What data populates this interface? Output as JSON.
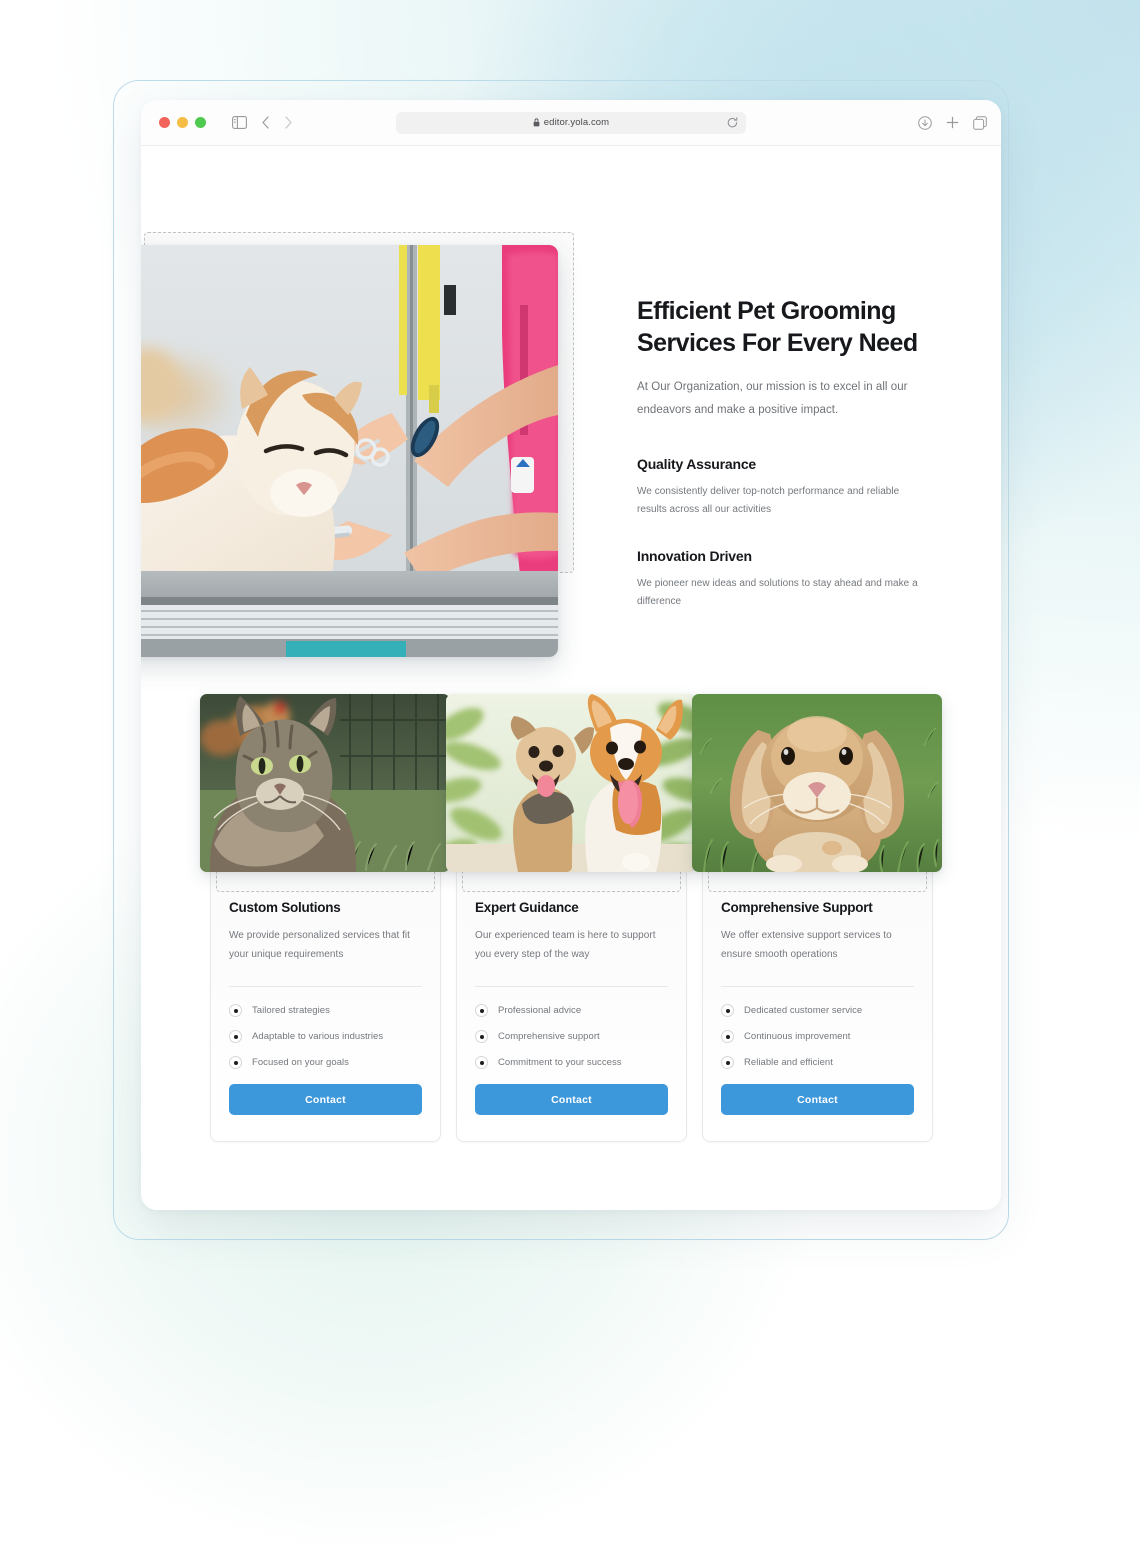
{
  "browser": {
    "url": "editor.yola.com",
    "lock_icon": "lock-icon",
    "reload_icon": "reload-icon",
    "sidebar_icon": "sidebar-toggle-icon",
    "back_icon": "back-chevron-icon",
    "forward_icon": "forward-chevron-icon",
    "shield_icon": "privacy-shield-icon",
    "download_icon": "download-icon",
    "new_tab_icon": "plus-icon",
    "tabs_icon": "tab-overview-icon"
  },
  "hero": {
    "image_alt": "pet-groomer-trimming-cat",
    "title": "Efficient Pet Grooming Services For Every Need",
    "lede": "At Our Organization, our mission is to excel in all our endeavors and make a positive impact.",
    "features": [
      {
        "heading": "Quality Assurance",
        "body": "We consistently deliver top-notch performance and reliable results across all our activities"
      },
      {
        "heading": "Innovation Driven",
        "body": "We pioneer new ideas and solutions to stay ahead and make a difference"
      }
    ]
  },
  "cards": [
    {
      "image_alt": "tabby-cat-in-grass",
      "title": "Custom Solutions",
      "body": "We provide personalized services that fit your unique requirements",
      "bullets": [
        "Tailored strategies",
        "Adaptable to various industries",
        "Focused on your goals"
      ],
      "button": "Contact"
    },
    {
      "image_alt": "two-dogs-in-greenery",
      "title": "Expert Guidance",
      "body": "Our experienced team is here to support you every step of the way",
      "bullets": [
        "Professional advice",
        "Comprehensive support",
        "Commitment to your success"
      ],
      "button": "Contact"
    },
    {
      "image_alt": "lop-eared-rabbit-on-grass",
      "title": "Comprehensive Support",
      "body": "We offer extensive support services to ensure smooth operations",
      "bullets": [
        "Dedicated customer service",
        "Continuous improvement",
        "Reliable and efficient"
      ],
      "button": "Contact"
    }
  ],
  "colors": {
    "accent": "#3d97db",
    "heading": "#16181c",
    "body_text": "#74787d",
    "dashed_outline": "#c2c2c2",
    "background_blue": "#c3e2ec",
    "background_mint": "#e4f4ef"
  }
}
